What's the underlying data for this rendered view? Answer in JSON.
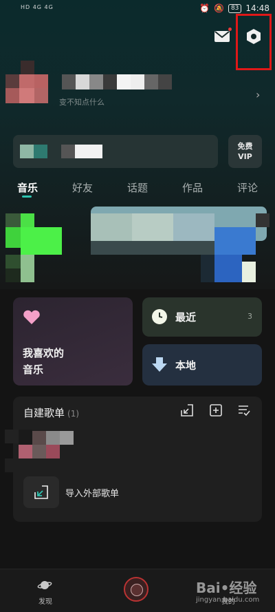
{
  "status_bar": {
    "network": "HD 4G 4G",
    "battery": "83",
    "time": "14:48"
  },
  "header": {
    "mail_icon": "mail-icon",
    "settings_icon": "hexagon-settings-icon"
  },
  "profile": {
    "subtitle": "变不知点什么"
  },
  "vip_button": {
    "line1": "免费",
    "line2": "VIP"
  },
  "tabs": [
    {
      "label": "音乐"
    },
    {
      "label": "好友"
    },
    {
      "label": "话题"
    },
    {
      "label": "作品"
    },
    {
      "label": "评论"
    }
  ],
  "cards": {
    "favorite": {
      "label_line1": "我喜欢的",
      "label_line2": "音乐"
    },
    "recent": {
      "label": "最近",
      "count": "3"
    },
    "local": {
      "label": "本地"
    }
  },
  "playlists": {
    "title": "自建歌单",
    "count": "(1)",
    "import_label": "导入外部歌单"
  },
  "bottom_nav": {
    "discover": "发现",
    "mine": "我的"
  },
  "watermark": {
    "main": "Bai•经验",
    "sub": "jingyan.baidu.com"
  },
  "colors": {
    "accent": "#2ec4b0",
    "highlight": "#e01818"
  }
}
